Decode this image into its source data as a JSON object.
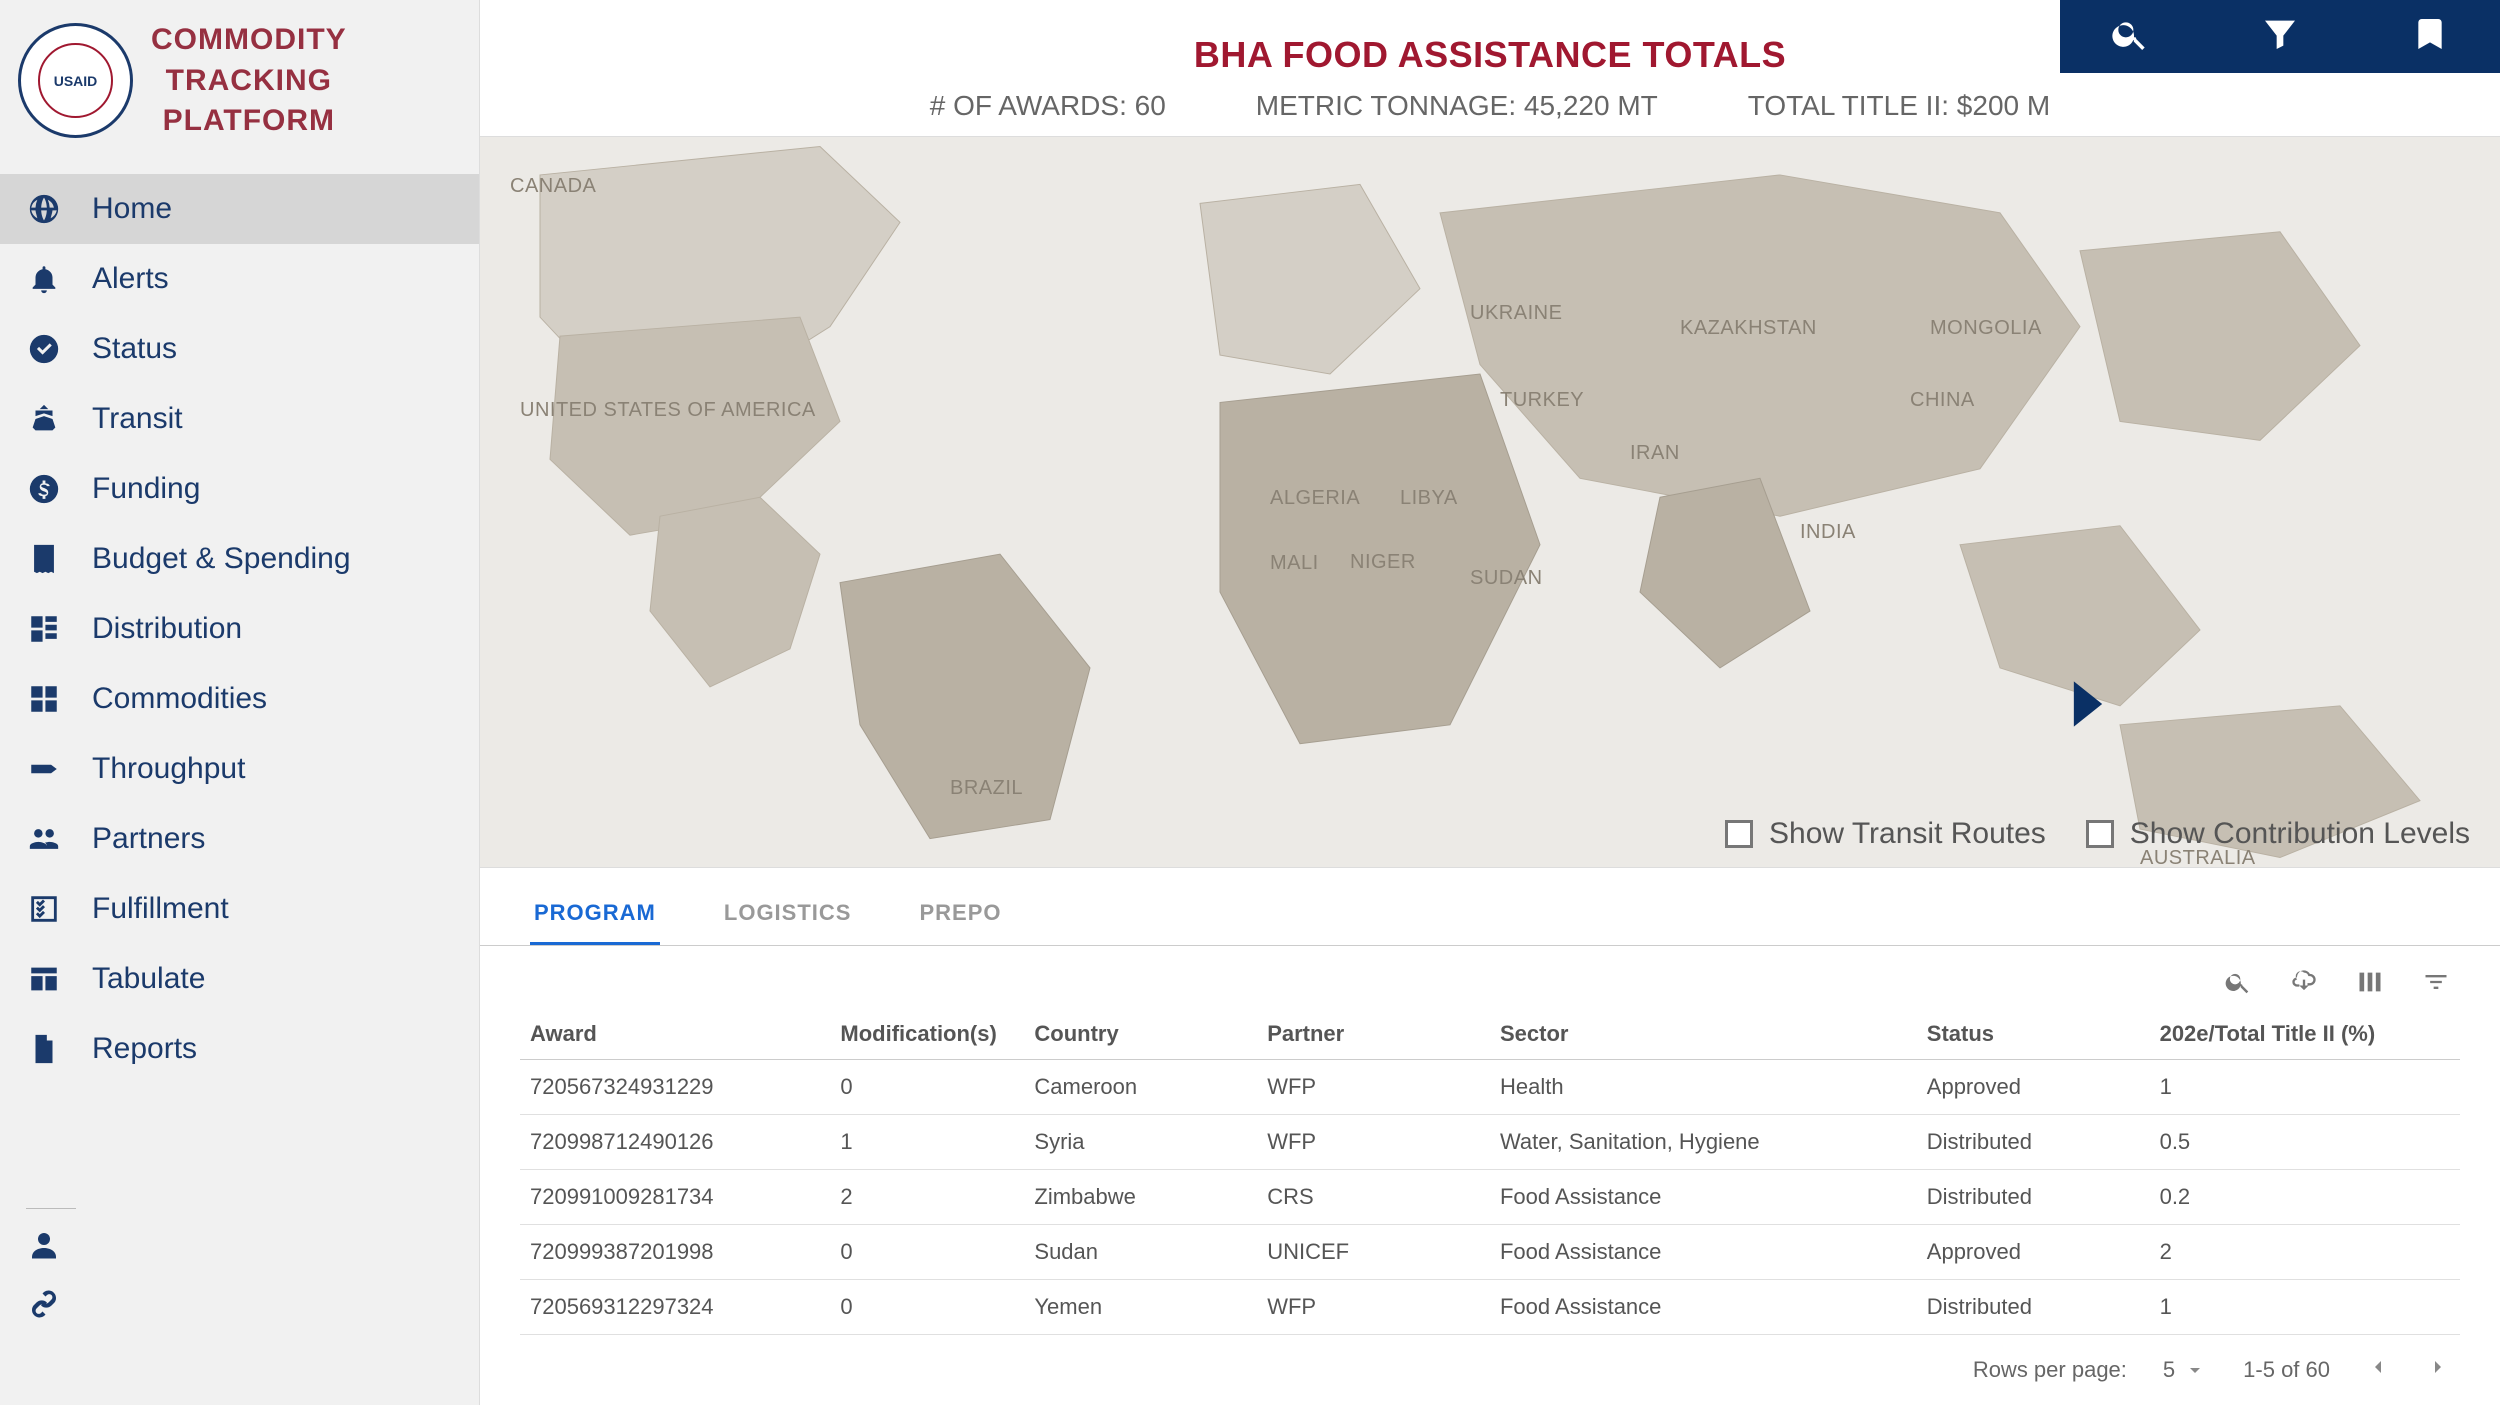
{
  "app": {
    "title_line1": "COMMODITY",
    "title_line2": "TRACKING",
    "title_line3": "PLATFORM",
    "seal_text": "USAID"
  },
  "sidebar": {
    "items": [
      {
        "label": "Home",
        "icon": "globe-icon",
        "active": true
      },
      {
        "label": "Alerts",
        "icon": "bell-icon"
      },
      {
        "label": "Status",
        "icon": "check-circle-icon"
      },
      {
        "label": "Transit",
        "icon": "ship-icon"
      },
      {
        "label": "Funding",
        "icon": "dollar-icon"
      },
      {
        "label": "Budget & Spending",
        "icon": "receipt-icon"
      },
      {
        "label": "Distribution",
        "icon": "hierarchy-icon"
      },
      {
        "label": "Commodities",
        "icon": "boxes-icon"
      },
      {
        "label": "Throughput",
        "icon": "arrow-tag-icon"
      },
      {
        "label": "Partners",
        "icon": "people-icon"
      },
      {
        "label": "Fulfillment",
        "icon": "checklist-icon"
      },
      {
        "label": "Tabulate",
        "icon": "table-icon"
      },
      {
        "label": "Reports",
        "icon": "file-icon"
      }
    ]
  },
  "kpi": {
    "title": "BHA FOOD ASSISTANCE TOTALS",
    "awards_label": "# OF AWARDS:",
    "awards_value": "60",
    "tonnage_label": "METRIC TONNAGE:",
    "tonnage_value": "45,220 MT",
    "title_ii_label": "TOTAL TITLE II:",
    "title_ii_value": "$200 M"
  },
  "map": {
    "labels": [
      "CANADA",
      "UNITED STATES OF AMERICA",
      "BRAZIL",
      "ALGERIA",
      "LIBYA",
      "MALI",
      "NIGER",
      "SUDAN",
      "UKRAINE",
      "TURKEY",
      "IRAN",
      "KAZAKHSTAN",
      "MONGOLIA",
      "CHINA",
      "INDIA",
      "AUSTRALIA"
    ],
    "toggle_transit": "Show Transit Routes",
    "toggle_contribution": "Show Contribution Levels"
  },
  "tabs": [
    {
      "label": "PROGRAM",
      "active": true
    },
    {
      "label": "LOGISTICS"
    },
    {
      "label": "PREPO"
    }
  ],
  "table": {
    "columns": [
      "Award",
      "Modification(s)",
      "Country",
      "Partner",
      "Sector",
      "Status",
      "202e/Total Title II (%)"
    ],
    "rows": [
      [
        "720567324931229",
        "0",
        "Cameroon",
        "WFP",
        "Health",
        "Approved",
        "1"
      ],
      [
        "720998712490126",
        "1",
        "Syria",
        "WFP",
        "Water, Sanitation, Hygiene",
        "Distributed",
        "0.5"
      ],
      [
        "720991009281734",
        "2",
        "Zimbabwe",
        "CRS",
        "Food Assistance",
        "Distributed",
        "0.2"
      ],
      [
        "720999387201998",
        "0",
        "Sudan",
        "UNICEF",
        "Food Assistance",
        "Approved",
        "2"
      ],
      [
        "720569312297324",
        "0",
        "Yemen",
        "WFP",
        "Food Assistance",
        "Distributed",
        "1"
      ]
    ]
  },
  "paginator": {
    "rows_label": "Rows per page:",
    "rows_value": "5",
    "range_label": "1-5 of 60"
  }
}
